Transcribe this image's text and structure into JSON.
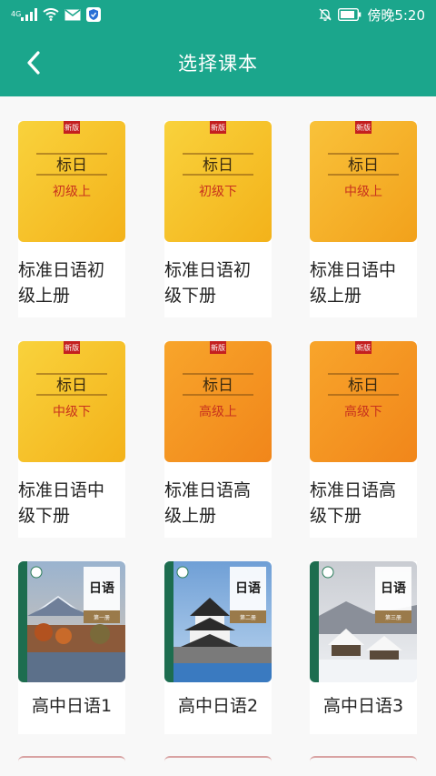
{
  "status_bar": {
    "network": "4G",
    "time": "傍晚5:20"
  },
  "header": {
    "title": "选择课本"
  },
  "books": [
    {
      "label": "标准日语初级上册",
      "cover_title": "标日",
      "cover_sub": "初级上",
      "badge": "新版",
      "style": "yellow"
    },
    {
      "label": "标准日语初级下册",
      "cover_title": "标日",
      "cover_sub": "初级下",
      "badge": "新版",
      "style": "yellow"
    },
    {
      "label": "标准日语中级上册",
      "cover_title": "标日",
      "cover_sub": "中级上",
      "badge": "新版",
      "style": "orange"
    },
    {
      "label": "标准日语中级下册",
      "cover_title": "标日",
      "cover_sub": "中级下",
      "badge": "新版",
      "style": "yellow"
    },
    {
      "label": "标准日语高级上册",
      "cover_title": "标日",
      "cover_sub": "高级上",
      "badge": "新版",
      "style": "orange"
    },
    {
      "label": "标准日语高级下册",
      "cover_title": "标日",
      "cover_sub": "高级下",
      "badge": "新版",
      "style": "orange"
    },
    {
      "label": "高中日语1",
      "cover_title": "日语",
      "cover_sub": "第一册",
      "style": "photo-fuji"
    },
    {
      "label": "高中日语2",
      "cover_title": "日语",
      "cover_sub": "第二册",
      "style": "photo-castle"
    },
    {
      "label": "高中日语3",
      "cover_title": "日语",
      "cover_sub": "第三册",
      "style": "photo-snow"
    }
  ],
  "colors": {
    "primary": "#1ba68c",
    "badge": "#c41f1f",
    "cover_yellow": "#f7c21e",
    "cover_orange": "#f59a1f",
    "cover_text_red": "#c8321e"
  }
}
